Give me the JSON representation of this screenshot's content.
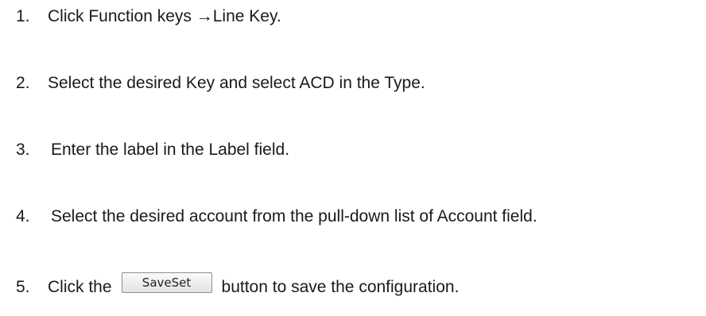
{
  "steps": [
    {
      "number": "1.",
      "text": "Click Function keys →Line Key."
    },
    {
      "number": "2.",
      "text": "Select the desired Key and select ACD in the Type."
    },
    {
      "number": "3.",
      "text": "Enter the label in the Label field."
    },
    {
      "number": "4.",
      "text": "Select the desired account from the pull-down list of Account field."
    },
    {
      "number": "5.",
      "text_before": "Click the",
      "button_label": "SaveSet",
      "text_after": "button to save the configuration."
    }
  ]
}
